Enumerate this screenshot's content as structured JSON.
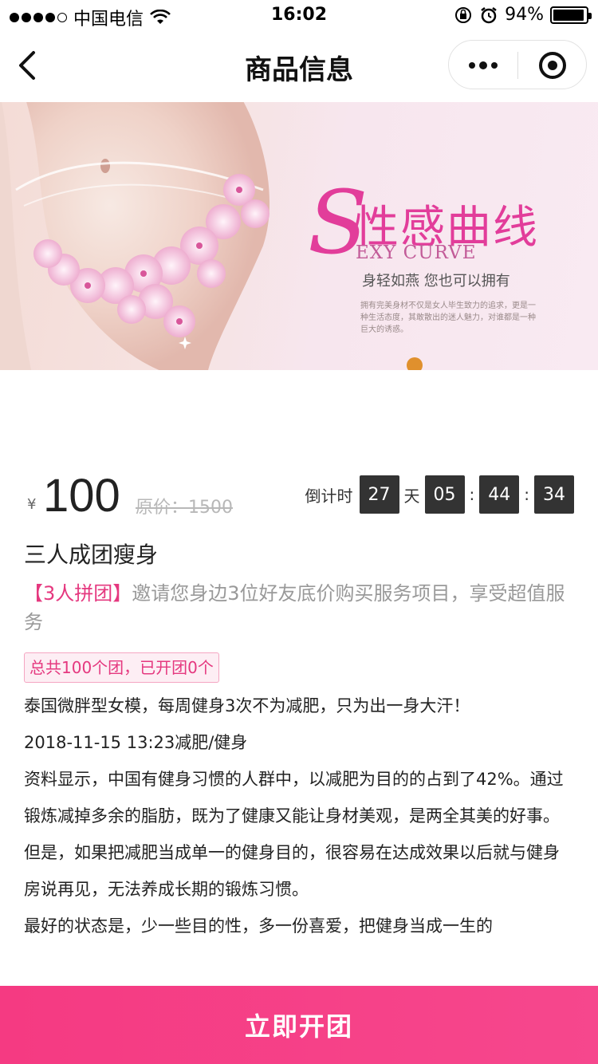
{
  "status_bar": {
    "carrier": "中国电信",
    "time": "16:02",
    "battery": "94%",
    "battery_level": 0.94
  },
  "nav": {
    "title": "商品信息"
  },
  "banner": {
    "s_letter": "S",
    "title": "性感曲线",
    "subtitle": "EXY CURVE",
    "tagline": "身轻如燕 您也可以拥有",
    "small_text": "拥有完美身材不仅是女人毕生致力的追求，更是一种生活态度，其敢散出的迷人魅力，对谁都是一种巨大的诱惑。"
  },
  "price": {
    "currency": "¥",
    "value": "100",
    "original": "原价：1500"
  },
  "countdown": {
    "label": "倒计时",
    "days": "27",
    "day_unit": "天",
    "hours": "05",
    "minutes": "44",
    "seconds": "34",
    "sep": ":"
  },
  "product": {
    "title": "三人成团瘦身",
    "promo_tag": "【3人拼团】",
    "promo_text": "邀请您身边3位好友底价购买服务项目，享受超值服务",
    "group_badge": "总共100个团，已开团0个"
  },
  "content": {
    "lines": [
      "泰国微胖型女模，每周健身3次不为减肥，只为出一身大汗！",
      "2018-11-15 13:23减肥/健身"
    ],
    "paragraph1": "资料显示，中国有健身习惯的人群中，以减肥为目的的占到了42%。通过锻炼减掉多余的脂肪，既为了健康又能让身材美观，是两全其美的好事。但是，如果把减肥当成单一的健身目的，很容易在达成效果以后就与健身房说再见，无法养成长期的锻炼习惯。",
    "paragraph2": "最好的状态是，少一些目的性，多一份喜爱，把健身当成一生的"
  },
  "cta": {
    "label": "立即开团"
  }
}
